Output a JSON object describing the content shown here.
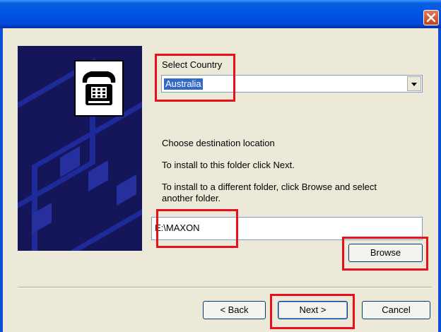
{
  "window": {
    "close_icon": "close-icon"
  },
  "country": {
    "label": "Select Country",
    "selected": "Australia"
  },
  "destination": {
    "heading": "Choose destination location",
    "instruction_next": "To install to this folder click Next.",
    "instruction_browse_line1": "To install to a different folder, click Browse and select",
    "instruction_browse_line2": "another folder.",
    "path": "E:\\MAXON",
    "browse_label": "Browse"
  },
  "footer": {
    "back_label": "< Back",
    "next_label": "Next >",
    "cancel_label": "Cancel"
  },
  "colors": {
    "highlight": "#e8101a",
    "titlebar": "#0055e5",
    "selection": "#316ac5"
  }
}
